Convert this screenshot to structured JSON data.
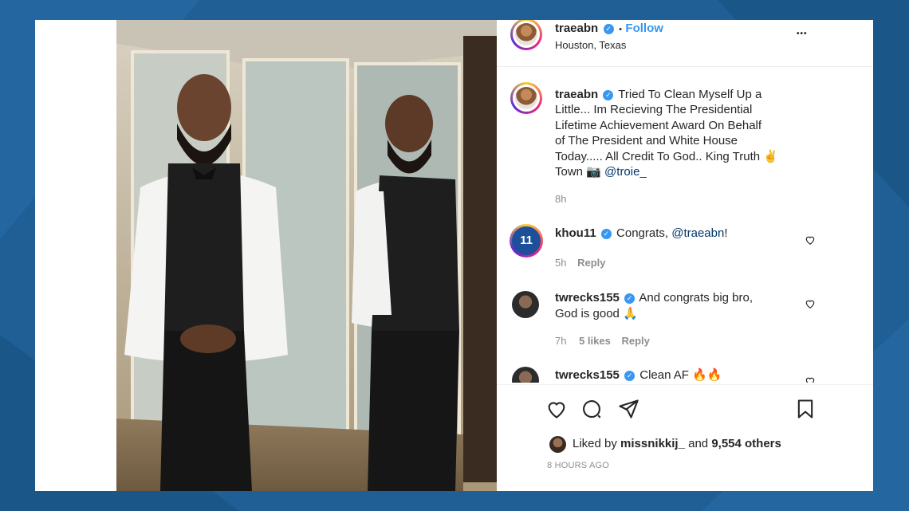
{
  "post": {
    "author": "traeabn",
    "follow_label": "Follow",
    "dot": "•",
    "location": "Houston, Texas",
    "more": "•••",
    "caption_user": "traeabn",
    "caption_lines": [
      "Tried To Clean Myself Up a",
      "Little... Im Recieving The Presidential",
      "Lifetime Achievement Award On Behalf",
      "of The President and White House",
      "Today..... All Credit To God.. King Truth ✌",
      "Town 📷"
    ],
    "caption_mention": "@troie_",
    "caption_time": "8h"
  },
  "comments": [
    {
      "user": "khou11",
      "text": "Congrats, ",
      "mention": "@traeabn",
      "after": "!",
      "time": "5h",
      "reply": "Reply"
    },
    {
      "user": "twrecks155",
      "text_line1": "And congrats big bro,",
      "text_line2": "God is good 🙏",
      "time": "7h",
      "likes": "5 likes",
      "reply": "Reply"
    },
    {
      "user": "twrecks155",
      "text": "Clean AF 🔥🔥"
    }
  ],
  "actions": {
    "liked_prefix": "Liked by ",
    "liked_user": "missnikkij_",
    "liked_mid": " and ",
    "liked_count": "9,554 others",
    "timestamp": "8 HOURS AGO"
  },
  "colors": {
    "accent": "#3897f0",
    "background": "#1f5f96",
    "fire": "#e8541d"
  },
  "badge": {
    "logo_text": "11"
  }
}
